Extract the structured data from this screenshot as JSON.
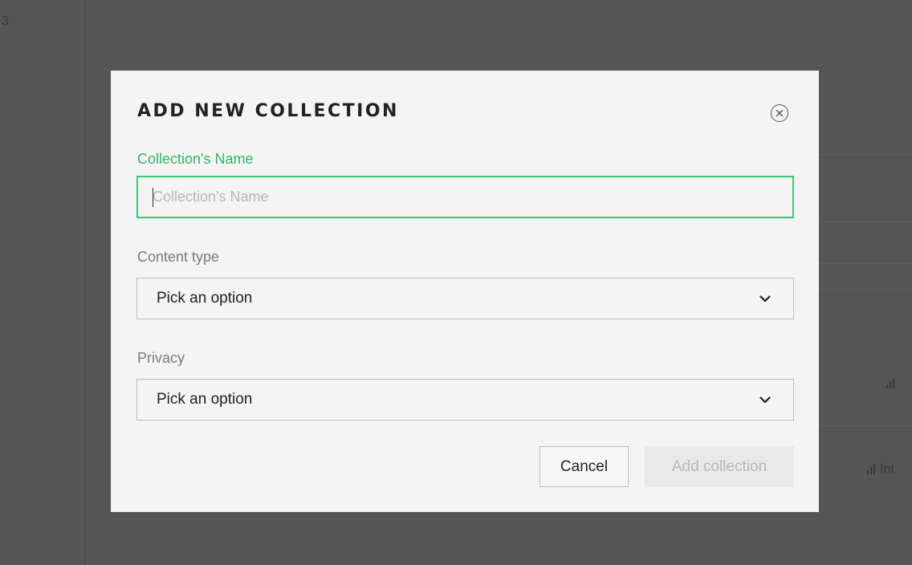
{
  "background": {
    "page_number": "3",
    "stats_label": "Int"
  },
  "modal": {
    "title": "ADD NEW COLLECTION",
    "close_icon": "close-circle-icon",
    "name_field": {
      "label": "Collection's Name",
      "value": "",
      "placeholder": "Collection's Name"
    },
    "content_type": {
      "label": "Content type",
      "selected": "Pick an option"
    },
    "privacy": {
      "label": "Privacy",
      "selected": "Pick an option"
    },
    "cancel_label": "Cancel",
    "submit_label": "Add collection"
  },
  "colors": {
    "accent": "#2db869",
    "input_focus_border": "#3cc574",
    "overlay": "#555555",
    "modal_bg": "#f4f4f4",
    "disabled_button_bg": "#e9e9e9",
    "disabled_button_text": "#b9b9b9"
  }
}
